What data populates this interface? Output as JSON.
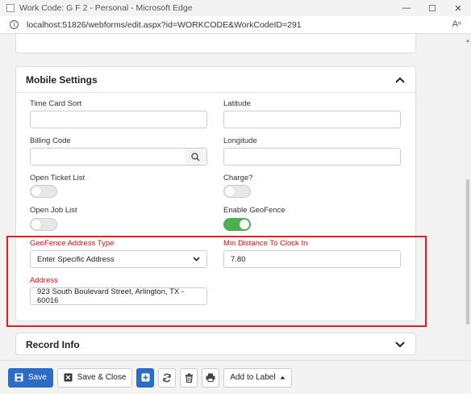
{
  "window": {
    "title": "Work Code: G F 2 - Personal - Microsoft Edge"
  },
  "browser": {
    "url": "localhost:51826/webforms/edit.aspx?id=WORKCODE&WorkCodeID=291"
  },
  "mobile_settings": {
    "header": "Mobile Settings",
    "time_card_sort": {
      "label": "Time Card Sort",
      "value": ""
    },
    "latitude": {
      "label": "Latitude",
      "value": ""
    },
    "billing_code": {
      "label": "Billing Code",
      "value": ""
    },
    "longitude": {
      "label": "Longitude",
      "value": ""
    },
    "open_ticket_list": {
      "label": "Open Ticket List",
      "on": false
    },
    "charge": {
      "label": "Charge?",
      "on": false
    },
    "open_job_list": {
      "label": "Open Job List",
      "on": false
    },
    "enable_geofence": {
      "label": "Enable GeoFence",
      "on": true
    },
    "geofence_address_type": {
      "label": "GeoFence Address Type",
      "value": "Enter Specific Address"
    },
    "min_distance": {
      "label": "Min Distance To Clock In",
      "value": "7.80"
    },
    "address": {
      "label": "Address",
      "value": "923 South Boulevard Street, Arlington, TX - 60016"
    }
  },
  "record_info": {
    "header": "Record Info"
  },
  "toolbar": {
    "save_label": "Save",
    "save_close_label": "Save & Close",
    "add_to_label_label": "Add to Label"
  },
  "colors": {
    "primary": "#2d6bc9",
    "required_label": "#dd1111",
    "highlight_border": "#e02020",
    "toggle_on": "#4caf50"
  }
}
